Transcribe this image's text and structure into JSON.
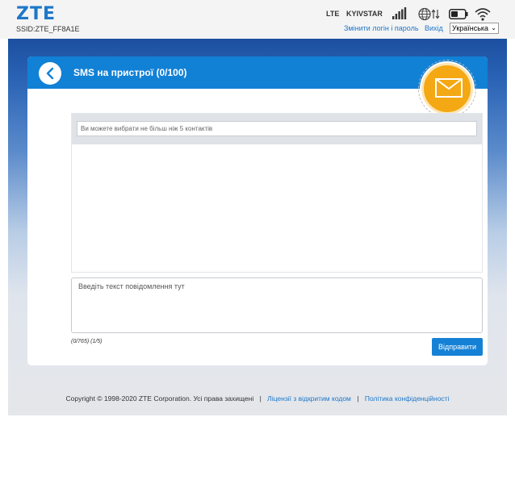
{
  "header": {
    "logo": "ZTE",
    "ssid": "SSID:ZTE_FF8A1E",
    "network_type": "LTE",
    "operator": "KYIVSTAR",
    "change_login_link": "Змінити логін і пароль",
    "logout_link": "Вихід",
    "language": "Українська",
    "icons": [
      "signal-bars-icon",
      "globe-transfer-icon",
      "battery-icon",
      "wifi-icon"
    ]
  },
  "sms_card": {
    "title": "SMS на пристрої (0/100)",
    "contacts_placeholder": "Ви можете вибрати не більш ніж 5 контактів",
    "message_placeholder": "Введіть текст повідомлення  тут",
    "counter": "(0/765) (1/5)",
    "send_label": "Відправити"
  },
  "footer": {
    "copyright": "Copyright © 1998-2020 ZTE Corporation. Усі права захищені",
    "separator": "|",
    "license_link": "Ліцензії з відкритим кодом",
    "privacy_link": "Політика конфіденційності"
  },
  "colors": {
    "accent": "#1181d6",
    "brand": "#1e77c8",
    "mail_badge": "#f4a813",
    "gradient_top": "#1c4fa0"
  }
}
